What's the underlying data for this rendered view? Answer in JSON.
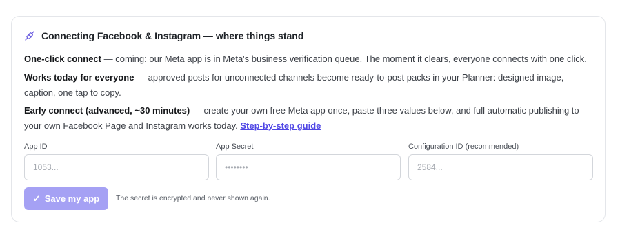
{
  "header": {
    "icon": "plug-connection-icon",
    "title": "Connecting Facebook & Instagram — where things stand"
  },
  "paragraphs": {
    "one_click": {
      "label": "One-click connect",
      "text": " — coming: our Meta app is in Meta's business verification queue. The moment it clears, everyone connects with one click."
    },
    "works_today": {
      "label": "Works today for everyone",
      "text": " — approved posts for unconnected channels become ready-to-post packs in your Planner: designed image, caption, one tap to copy."
    },
    "early_connect": {
      "label": "Early connect (advanced, ~30 minutes)",
      "text": " — create your own free Meta app once, paste three values below, and full automatic publishing to your own Facebook Page and Instagram works today. ",
      "link": "Step-by-step guide"
    }
  },
  "form": {
    "app_id": {
      "label": "App ID",
      "placeholder": "1053..."
    },
    "app_secret": {
      "label": "App Secret",
      "placeholder": "••••••••"
    },
    "config_id": {
      "label": "Configuration ID (recommended)",
      "placeholder": "2584..."
    }
  },
  "actions": {
    "save_label": "Save my app",
    "note": "The secret is encrypted and never shown again."
  },
  "colors": {
    "accent": "#4f46e5",
    "button_disabled": "#a5a1f4",
    "border": "#e4e6ea"
  }
}
